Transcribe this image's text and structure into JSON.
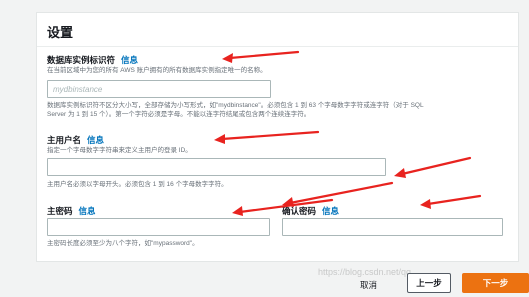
{
  "panel": {
    "title": "设置"
  },
  "instance_id": {
    "label": "数据库实例标识符",
    "info": "信息",
    "description": "在当前区域中为您的所有 AWS 账户拥有的所有数据库实例指定唯一的名称。",
    "placeholder": "mydbinstance",
    "value": "",
    "constraints_line1": "数据库实例标识符不区分大小写，全部存储为小写形式，如\"mydbinstance\"。必须包含 1 到 63 个字母数字字符或连字符（对于 SQL",
    "constraints_line2": "Server 为 1 到 15 个）。第一个字符必须是字母。不能以连字符结尾或包含两个连续连字符。"
  },
  "master_username": {
    "label": "主用户名",
    "info": "信息",
    "description": "指定一个字母数字字符串来定义主用户的登录 ID。",
    "value": "",
    "constraints": "主用户名必须以字母开头。必须包含 1 到 16 个字母数字字符。"
  },
  "master_password": {
    "label": "主密码",
    "info": "信息",
    "value": "",
    "constraints": "主密码长度必须至少为八个字符，如\"mypassword\"。"
  },
  "confirm_password": {
    "label": "确认密码",
    "info": "信息",
    "value": ""
  },
  "footer": {
    "cancel_label": "取消",
    "previous_label": "上一步",
    "next_label": "下一步"
  },
  "watermark": "https://blog.csdn.net/qq_...",
  "colors": {
    "accent_link": "#0073bb",
    "primary_button": "#ec7211",
    "annotation_arrow": "#e8231f"
  }
}
